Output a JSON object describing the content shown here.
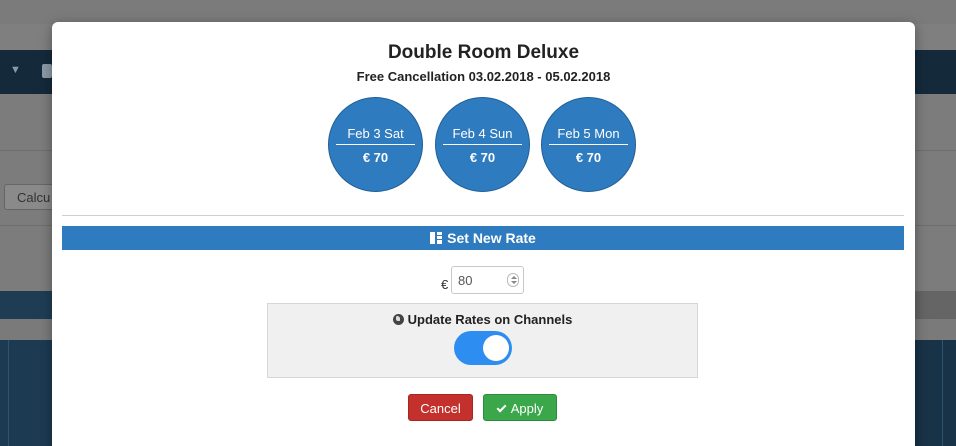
{
  "background": {
    "calc_button_label": "Calcu"
  },
  "modal": {
    "title": "Double Room Deluxe",
    "subtitle": "Free Cancellation 03.02.2018 - 05.02.2018",
    "days": [
      {
        "label": "Feb 3 Sat",
        "price": "€ 70"
      },
      {
        "label": "Feb 4 Sun",
        "price": "€ 70"
      },
      {
        "label": "Feb 5 Mon",
        "price": "€ 70"
      }
    ],
    "rate_section": {
      "title": "Set New Rate",
      "icon": "calculator-icon",
      "currency_symbol": "€",
      "rate_value": "80"
    },
    "channels": {
      "label": "Update Rates on Channels",
      "icon": "globe-icon",
      "toggle_on": true
    },
    "buttons": {
      "cancel_label": "Cancel",
      "apply_label": "Apply"
    },
    "colors": {
      "primary": "#2f7bbf",
      "toggle": "#2e8df0",
      "cancel": "#c4302b",
      "apply": "#3aa84a"
    }
  }
}
